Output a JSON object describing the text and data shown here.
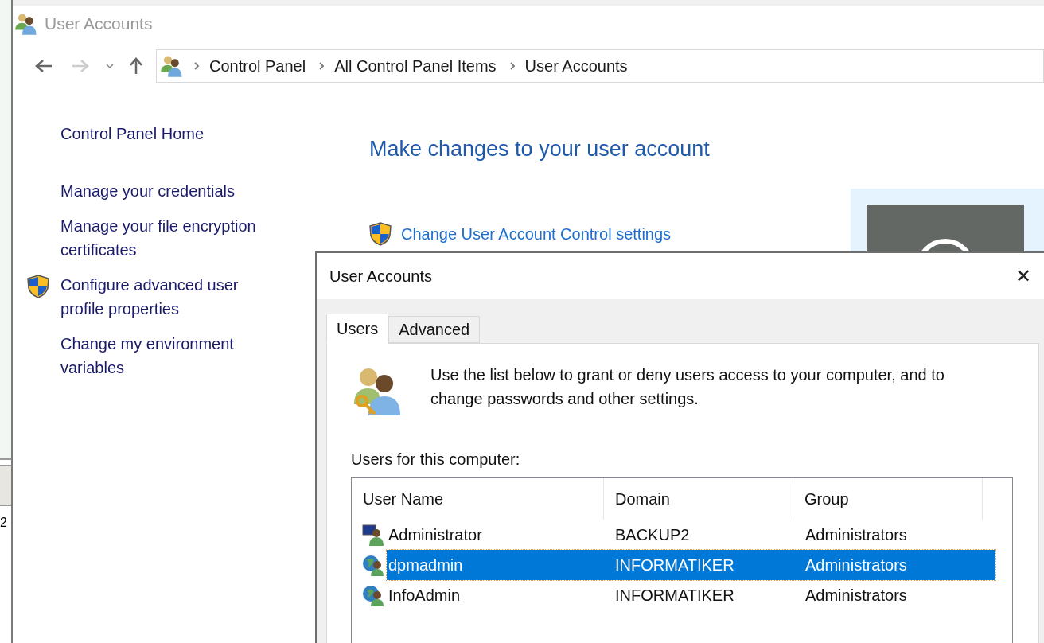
{
  "window": {
    "title": "User Accounts"
  },
  "edge_fragment": "2",
  "breadcrumb": [
    "Control Panel",
    "All Control Panel Items",
    "User Accounts"
  ],
  "sidebar": {
    "items": [
      {
        "label": "Control Panel Home",
        "kind": "plain"
      },
      {
        "label": "Manage your credentials",
        "kind": "plain"
      },
      {
        "label": "Manage your file encryption certificates",
        "kind": "plain"
      },
      {
        "label": "Configure advanced user profile properties",
        "kind": "shield"
      },
      {
        "label": "Change my environment variables",
        "kind": "plain"
      }
    ]
  },
  "main": {
    "heading": "Make changes to your user account",
    "links": [
      {
        "label": "Change User Account Control settings",
        "kind": "shield"
      }
    ]
  },
  "dialog": {
    "title": "User Accounts",
    "close": "✕",
    "tabs": [
      {
        "label": "Users",
        "selected": true
      },
      {
        "label": "Advanced",
        "selected": false
      }
    ],
    "intro": "Use the list below to grant or deny users access to your computer, and to change passwords and other settings.",
    "list_label": "Users for this computer:",
    "table": {
      "columns": [
        "User Name",
        "Domain",
        "Group"
      ],
      "rows": [
        {
          "kind": "local",
          "cells": [
            "Administrator",
            "BACKUP2",
            "Administrators"
          ],
          "selected": false
        },
        {
          "kind": "domain",
          "cells": [
            "dpmadmin",
            "INFORMATIKER",
            "Administrators"
          ],
          "selected": true
        },
        {
          "kind": "domain",
          "cells": [
            "InfoAdmin",
            "INFORMATIKER",
            "Administrators"
          ],
          "selected": false
        }
      ]
    }
  }
}
